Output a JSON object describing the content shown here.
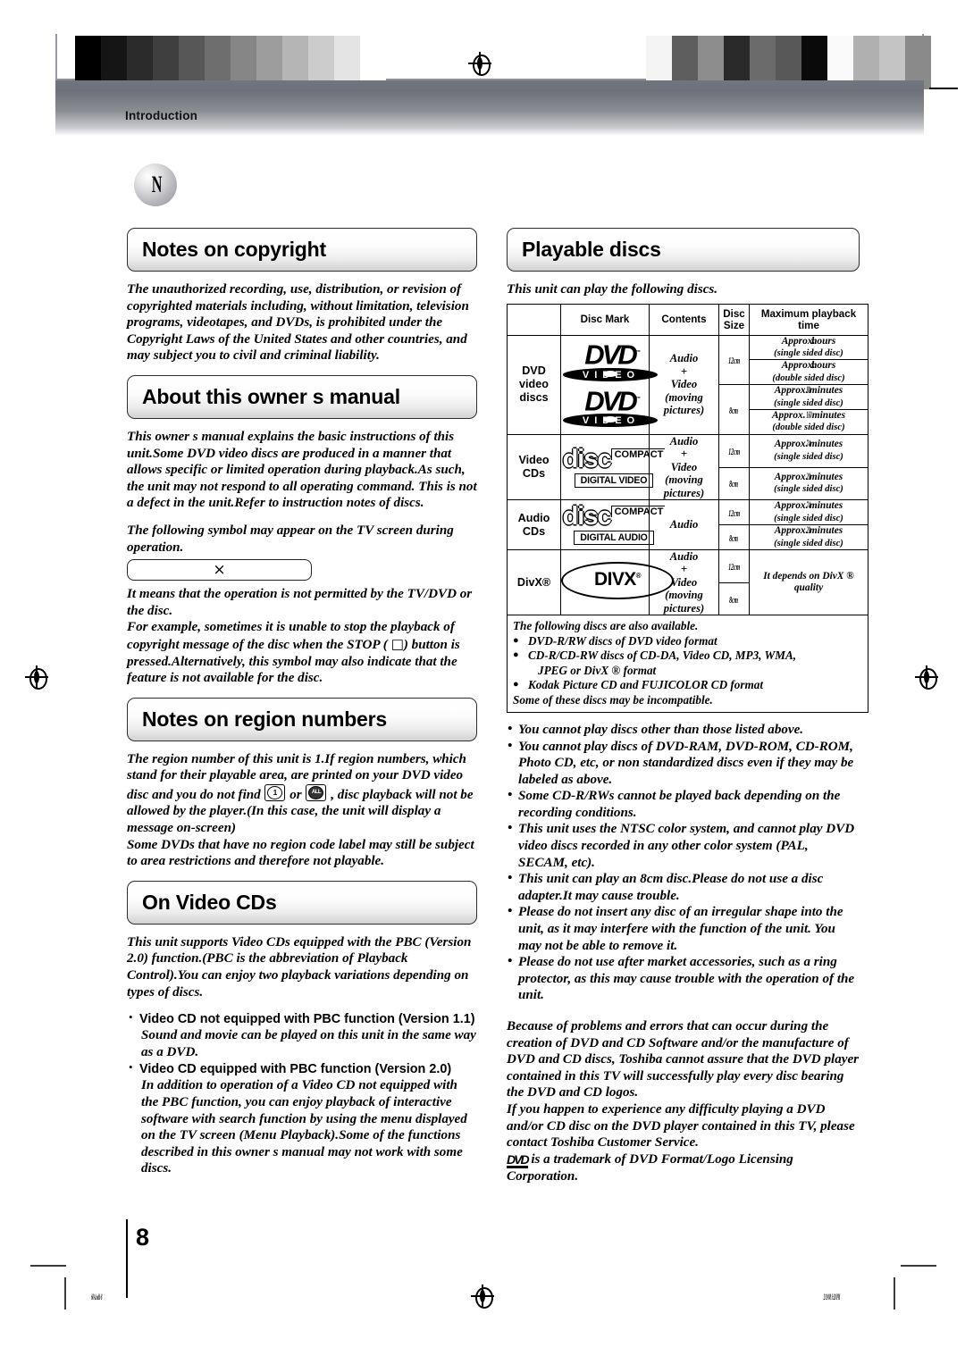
{
  "running_head": "Introduction",
  "badge_glyph": "N",
  "page_number": "8",
  "footer": {
    "left": "60A.indb   8",
    "right": "2/19/08   3:28 PM"
  },
  "left_column": {
    "sections": [
      {
        "heading": "Notes on copyright",
        "paragraphs": [
          "The unauthorized recording, use, distribution, or revision of copyrighted materials including, without limitation, television programs, videotapes, and DVDs, is prohibited under the Copyright Laws of the United States and other countries, and may subject you to civil and criminal liability."
        ]
      },
      {
        "heading": "About this owner s manual",
        "paragraphs": [
          "This owner s manual explains the basic instructions of this unit.Some DVD video discs are produced in a manner that allows specific or limited operation during playback.As such, the unit may not respond to all operating command. This is not a defect in the unit.Refer to instruction notes of discs.",
          "The following symbol may appear on the TV screen during operation."
        ],
        "symbol_box": "×",
        "after_box": [
          "It means that the operation is not permitted by the TV/DVD or the disc.",
          "For example, sometimes it is unable to stop the playback of copyright message of the disc when the STOP (",
          ") button is pressed.Alternatively, this symbol may also indicate that the feature is not available for the disc."
        ],
        "stop_glyph": "□"
      },
      {
        "heading": "Notes on region numbers",
        "region_text_1": "The region number of this unit is 1.If region numbers, which stand for their playable area, are printed on your DVD video disc and you do not    find ",
        "region_chip_1": "1",
        "region_or": " or ",
        "region_chip_2": "ALL",
        "region_text_2": " , disc playback will not be allowed by the player.(In this case, the unit will display a message on-screen)",
        "region_text_3": "Some DVDs that have no region code label may still be subject to area restrictions and therefore not playable."
      },
      {
        "heading": "On Video CDs",
        "paragraphs": [
          "This unit supports Video CDs equipped with the PBC (Version 2.0) function.(PBC is the abbreviation of Playback Control).You can enjoy two playback variations depending on types of discs."
        ],
        "bullets": [
          {
            "title": "Video CD not equipped with PBC function (Version 1.1)",
            "body": "Sound and movie can be played on this unit in the same way as a DVD."
          },
          {
            "title": "Video CD equipped with PBC function (Version 2.0)",
            "body": "In addition to operation of a Video CD not equipped with the PBC function, you can enjoy playback of interactive software with search function by using the menu displayed on the TV screen (Menu Playback).Some of the functions described in this owner    s manual may not work with some discs."
          }
        ]
      }
    ]
  },
  "right_column": {
    "heading": "Playable discs",
    "intro": "This unit can play the following discs.",
    "table": {
      "headers": [
        "",
        "Disc Mark",
        "Contents",
        "Disc Size",
        "Maximum playback time"
      ],
      "rows": [
        {
          "category": "DVD video discs",
          "mark": "dvd-video-logo",
          "contents": [
            "Audio",
            "+",
            "Video",
            "(moving",
            "pictures)"
          ],
          "sizes": [
            {
              "size": "12cm",
              "times": [
                {
                  "prefix": "Approx.",
                  "num": "4",
                  "unit": "hours",
                  "note": "(single sided disc)"
                },
                {
                  "prefix": "Approx.",
                  "num": "8",
                  "unit": "hours",
                  "note": "(double sided disc)"
                }
              ]
            },
            {
              "size": "8cm",
              "times": [
                {
                  "prefix": "Approx.",
                  "num": "80",
                  "unit": "minutes",
                  "note": "(single sided disc)"
                },
                {
                  "prefix": "Approx.",
                  "num": "160",
                  "unit": "minutes",
                  "note": "(double sided disc)"
                }
              ]
            }
          ]
        },
        {
          "category": "Video CDs",
          "mark": "compact-disc-digital-video-logo",
          "contents": [
            "Audio",
            "+",
            "Video",
            "(moving",
            "pictures)"
          ],
          "sizes": [
            {
              "size": "12cm",
              "times": [
                {
                  "prefix": "Approx.",
                  "num": "74",
                  "unit": "minutes",
                  "note": "(single sided disc)"
                }
              ]
            },
            {
              "size": "8cm",
              "times": [
                {
                  "prefix": "Approx.",
                  "num": "20",
                  "unit": "minutes",
                  "note": "(single sided disc)"
                }
              ]
            }
          ]
        },
        {
          "category": "Audio CDs",
          "mark": "compact-disc-digital-audio-logo",
          "contents": [
            "Audio"
          ],
          "sizes": [
            {
              "size": "12cm",
              "times": [
                {
                  "prefix": "Approx.",
                  "num": "74",
                  "unit": "minutes",
                  "note": "(single sided disc)"
                }
              ]
            },
            {
              "size": "8cm",
              "times": [
                {
                  "prefix": "Approx.",
                  "num": "20",
                  "unit": "minutes",
                  "note": "(single sided disc)"
                }
              ]
            }
          ]
        },
        {
          "category": "DivX®",
          "mark": "divx-logo",
          "contents": [
            "Audio",
            "+",
            "Video",
            "(moving",
            "pictures)"
          ],
          "sizes": [
            {
              "size": "12cm",
              "times": []
            },
            {
              "size": "8cm",
              "times": []
            }
          ],
          "merged_time": "It depends on DivX ® quality"
        }
      ],
      "also_available": {
        "lead": "The following discs are also available.",
        "items": [
          "DVD-R/RW discs of DVD video format",
          "CD-R/CD-RW  discs  of  CD-DA,  Video  CD,  MP3,  WMA,",
          "JPEG or DivX ® format",
          "Kodak Picture CD and FUJICOLOR CD format"
        ],
        "tail": "Some of these discs may be incompatible."
      }
    },
    "notes": [
      "You cannot play discs other than those listed above.",
      "You cannot play discs of DVD-RAM, DVD-ROM, CD-ROM, Photo CD, etc, or non standardized discs even if they may be labeled as above.",
      "Some CD-R/RWs cannot be played back depending on the recording conditions.",
      "This unit uses the NTSC color system, and cannot play DVD video discs recorded in any other color system (PAL, SECAM, etc).",
      "This unit can play an 8cm disc.Please do not use a disc adapter.It may cause trouble.",
      "Please do not insert any disc of an irregular shape into the unit, as it may interfere with the function of the unit. You may not be able to remove it.",
      "Please do not use after market accessories, such as a ring protector, as this may cause trouble with the operation of the unit."
    ],
    "disclaimer": [
      "Because of problems and errors that can occur during the creation of DVD and CD Software and/or the manufacture of DVD and CD discs, Toshiba cannot assure that the DVD player contained in this TV will successfully play every disc bearing the DVD and CD logos.",
      "If you happen to experience any difficulty playing a DVD and/or CD disc on the DVD player contained in this TV, please contact Toshiba Customer Service."
    ],
    "trademark_tail": " is a trademark of DVD Format/Logo Licensing Corporation."
  },
  "calibration": {
    "left_swatches": [
      "#000000",
      "#151515",
      "#2b2b2b",
      "#3f3f3f",
      "#575757",
      "#6e6e6e",
      "#868686",
      "#9d9d9d",
      "#b5b5b5",
      "#cccccc",
      "#e4e4e4",
      "#ffffff"
    ],
    "right_swatches": [
      "#f4f4f4",
      "#5e5e5e",
      "#8d8d8d",
      "#2a2a2a",
      "#6b6b6b",
      "#585858",
      "#0a0a0a",
      "#fafafa",
      "#b0b0b0",
      "#c4c4c4",
      "#8a8a8a"
    ]
  }
}
